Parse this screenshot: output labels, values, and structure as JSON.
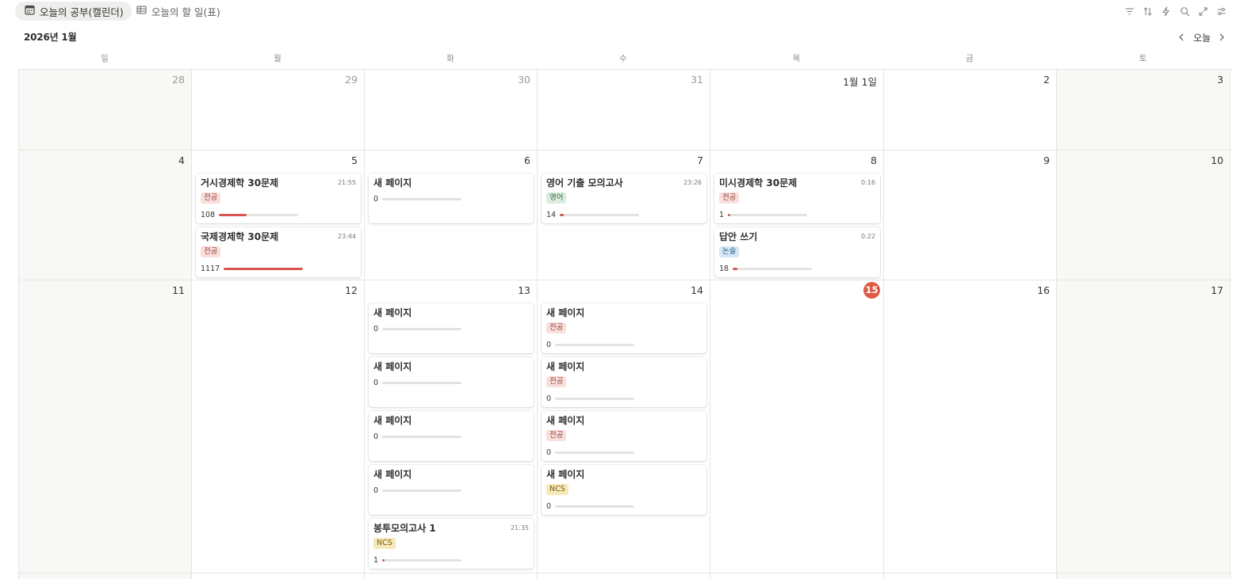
{
  "tabs": [
    {
      "label": "오늘의 공부(캘린더)",
      "icon": "calendar-icon",
      "active": true
    },
    {
      "label": "오늘의 할 일(표)",
      "icon": "table-icon",
      "active": false
    }
  ],
  "toolbar": [
    "filter-icon",
    "sort-icon",
    "automation-icon",
    "search-icon",
    "expand-icon",
    "settings-icon"
  ],
  "month_title": "2026년 1월",
  "today_label": "오늘",
  "weekdays": [
    "일",
    "월",
    "화",
    "수",
    "목",
    "금",
    "토"
  ],
  "accent_color": "#e05a47",
  "weeks": [
    {
      "days": [
        {
          "label": "28",
          "muted": true
        },
        {
          "label": "29",
          "muted": true
        },
        {
          "label": "30",
          "muted": true
        },
        {
          "label": "31",
          "muted": true
        },
        {
          "label": "1월 1일"
        },
        {
          "label": "2"
        },
        {
          "label": "3"
        }
      ]
    },
    {
      "days": [
        {
          "label": "4"
        },
        {
          "label": "5",
          "cards": [
            {
              "title": "거시경제학 30문제",
              "time": "21:55",
              "tag": "전공",
              "tag_type": "major",
              "value": "108",
              "progress": 0.35
            },
            {
              "title": "국제경제학 30문제",
              "time": "23:44",
              "tag": "전공",
              "tag_type": "major",
              "value": "1117",
              "progress": 1.0
            }
          ]
        },
        {
          "label": "6",
          "cards": [
            {
              "title": "새 페이지",
              "value": "0",
              "progress": 0
            }
          ]
        },
        {
          "label": "7",
          "cards": [
            {
              "title": "영어 기출 모의고사",
              "time": "23:26",
              "tag": "영어",
              "tag_type": "eng",
              "value": "14",
              "progress": 0.05
            }
          ]
        },
        {
          "label": "8",
          "cards": [
            {
              "title": "미시경제학 30문제",
              "time": "0:16",
              "tag": "전공",
              "tag_type": "major",
              "value": "1",
              "progress": 0.01
            },
            {
              "title": "답안 쓰기",
              "time": "0:22",
              "tag": "논술",
              "tag_type": "essay",
              "value": "18",
              "progress": 0.06
            }
          ]
        },
        {
          "label": "9"
        },
        {
          "label": "10"
        }
      ]
    },
    {
      "days": [
        {
          "label": "11"
        },
        {
          "label": "12"
        },
        {
          "label": "13",
          "cards": [
            {
              "title": "새 페이지",
              "value": "0",
              "progress": 0
            },
            {
              "title": "새 페이지",
              "value": "0",
              "progress": 0
            },
            {
              "title": "새 페이지",
              "value": "0",
              "progress": 0
            },
            {
              "title": "새 페이지",
              "value": "0",
              "progress": 0
            },
            {
              "title": "봉투모의고사 1",
              "time": "21:35",
              "tag": "NCS",
              "tag_type": "ncs",
              "value": "1",
              "progress": 0.01
            }
          ]
        },
        {
          "label": "14",
          "cards": [
            {
              "title": "새 페이지",
              "tag": "전공",
              "tag_type": "major",
              "value": "0",
              "progress": 0
            },
            {
              "title": "새 페이지",
              "tag": "전공",
              "tag_type": "major",
              "value": "0",
              "progress": 0
            },
            {
              "title": "새 페이지",
              "tag": "전공",
              "tag_type": "major",
              "value": "0",
              "progress": 0
            },
            {
              "title": "새 페이지",
              "tag": "NCS",
              "tag_type": "ncs",
              "value": "0",
              "progress": 0
            }
          ]
        },
        {
          "label": "15",
          "today": true
        },
        {
          "label": "16"
        },
        {
          "label": "17"
        }
      ]
    }
  ]
}
